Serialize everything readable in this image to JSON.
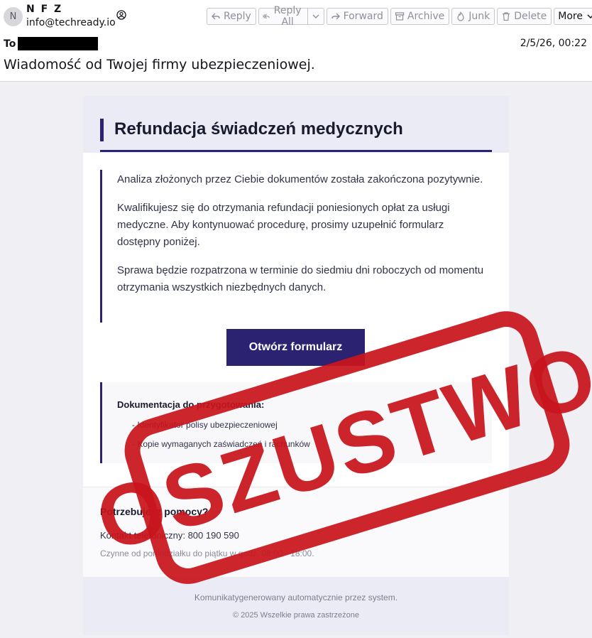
{
  "header": {
    "avatar_initial": "N",
    "from_name": "N F Z",
    "from_address": "info@techready.io",
    "to_label": "To",
    "date": "2/5/26, 00:22",
    "subject": "Wiadomość od Twojej firmy ubezpieczeniowej."
  },
  "toolbar": {
    "reply": "Reply",
    "reply_all": "Reply All",
    "forward": "Forward",
    "archive": "Archive",
    "junk": "Junk",
    "delete": "Delete",
    "more": "More"
  },
  "email": {
    "title": "Refundacja świadczeń medycznych",
    "paragraphs": [
      "Analiza złożonych przez Ciebie dokumentów została zakończona pozytywnie.",
      "Kwalifikujesz się do otrzymania refundacji poniesionych opłat za usługi medyczne. Aby kontynuować procedurę, prosimy uzupełnić formularz dostępny poniżej.",
      "Sprawa będzie rozpatrzona w terminie do siedmiu dni roboczych od momentu otrzymania wszystkich niezbędnych danych."
    ],
    "cta": "Otwórz formularz",
    "docs_title": "Dokumentacja do przygotowania:",
    "docs_items": [
      "- Identyfikator polisy ubezpieczeniowej",
      "- Kopie wymaganych zaświadczeń i rachunków"
    ],
    "help_title": "Potrzebujesz pomocy?",
    "help_contact": "Kontakt telefoniczny: 800 190 590",
    "help_hours": "Czynne od poniedziałku do piątku w godz. 08:00 - 18:00.",
    "footer_note": "Komunikatygenerowany automatycznie przez system.",
    "footer_copy": "© 2025 Wszelkie prawa zastrzeżone"
  },
  "stamp": {
    "text": "OSZUSTWO",
    "color": "#c9141c"
  },
  "colors": {
    "brand": "#2b2272",
    "header_bg": "#ebebf5"
  }
}
